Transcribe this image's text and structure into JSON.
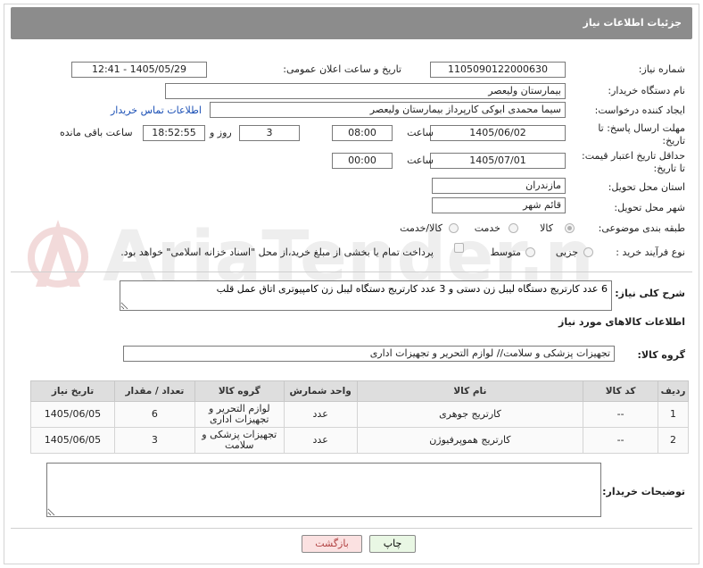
{
  "header": {
    "title": "جزئیات اطلاعات نیاز"
  },
  "form": {
    "need_number_label": "شماره نیاز:",
    "need_number": "1105090122000630",
    "announce_label": "تاریخ و ساعت اعلان عمومی:",
    "announce_value": "1405/05/29 - 12:41",
    "buyer_org_label": "نام دستگاه خریدار:",
    "buyer_org": "بیمارستان ولیعصر",
    "creator_label": "ایجاد کننده درخواست:",
    "creator": "سیما محمدی ابوکی کارپرداز بیمارستان ولیعصر",
    "contact_link": "اطلاعات تماس خریدار",
    "send_deadline_label_1": "مهلت ارسال پاسخ: تا",
    "send_deadline_label_2": "تاریخ:",
    "send_date": "1405/06/02",
    "time_label": "ساعت",
    "send_time": "08:00",
    "days_value": "3",
    "days_label": "روز و",
    "remaining_time": "18:52:55",
    "remaining_label": "ساعت باقی مانده",
    "validity_label_1": "حداقل تاریخ اعتبار قیمت:",
    "validity_label_2": "تا تاریخ:",
    "validity_date": "1405/07/01",
    "validity_time": "00:00",
    "province_label": "استان محل تحویل:",
    "province": "مازندران",
    "city_label": "شهر محل تحویل:",
    "city": "قائم شهر",
    "category_label": "طبقه بندی موضوعی:",
    "category_options": [
      "کالا",
      "خدمت",
      "کالا/خدمت"
    ],
    "category_selected": "کالا",
    "process_label": "نوع فرآیند خرید :",
    "process_options": [
      "جزیی",
      "متوسط"
    ],
    "process_selected": "جزیی",
    "payment_note": "پرداخت تمام یا بخشی از مبلغ خرید،از محل \"اسناد خزانه اسلامی\" خواهد بود.",
    "description_label": "شرح کلی نیاز:",
    "description": "6 عدد کارتریج دستگاه لیبل زن دستی و 3 عدد کارتریج دستگاه لیبل زن کامپیوتری اتاق عمل قلب",
    "items_title": "اطلاعات کالاهای مورد نیاز",
    "goods_group_label": "گروه کالا:",
    "goods_group": "تجهیزات پزشکی و سلامت// لوازم التحریر و تجهیزات اداری",
    "buyer_notes_label": "توضیحات خریدار:",
    "buyer_notes": ""
  },
  "table": {
    "headers": [
      "ردیف",
      "کد کالا",
      "نام کالا",
      "واحد شمارش",
      "گروه کالا",
      "تعداد / مقدار",
      "تاریخ نیاز"
    ],
    "rows": [
      [
        "1",
        "--",
        "کارتریج جوهری",
        "عدد",
        "لوازم التحریر و تجهیزات اداری",
        "6",
        "1405/06/05"
      ],
      [
        "2",
        "--",
        "کارتریج هموپرفیوژن",
        "عدد",
        "تجهیزات پزشکی و سلامت",
        "3",
        "1405/06/05"
      ]
    ]
  },
  "buttons": {
    "print": "چاپ",
    "back": "بازگشت"
  },
  "watermark": {
    "text": "AriaTender.neT"
  },
  "colors": {
    "header": "#8c8c8c",
    "link": "#1a4fb5",
    "print_btn": "#e9f7e4",
    "back_btn": "#fbe1e1"
  }
}
